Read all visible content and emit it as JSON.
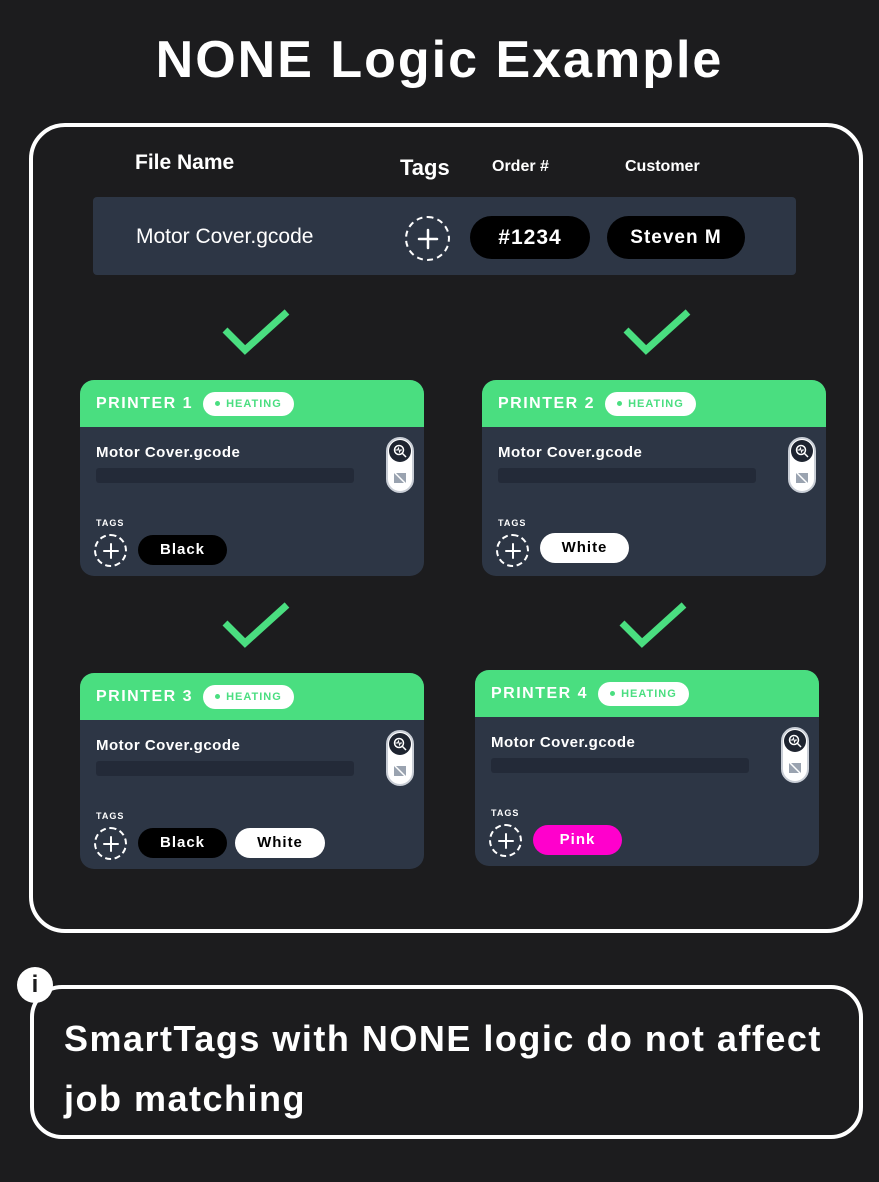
{
  "title": "NONE Logic Example",
  "columns": {
    "file_name": "File Name",
    "tags": "Tags",
    "order": "Order #",
    "customer": "Customer"
  },
  "file_row": {
    "file_name": "Motor Cover.gcode",
    "add_tag_icon": "plus-dashed-circle",
    "order": "#1234",
    "customer": "Steven M"
  },
  "colors": {
    "accent_green": "#4ade80",
    "card_bg": "#2d3645",
    "page_bg": "#1c1c1e",
    "pink_tag": "#ff00cc"
  },
  "match_icon": "checkmark",
  "printers": [
    {
      "name": "PRINTER 1",
      "status": "HEATING",
      "job": "Motor Cover.gcode",
      "tags_label": "TAGS",
      "tags": [
        {
          "label": "Black",
          "style": "black"
        }
      ]
    },
    {
      "name": "PRINTER 2",
      "status": "HEATING",
      "job": "Motor Cover.gcode",
      "tags_label": "TAGS",
      "tags": [
        {
          "label": "White",
          "style": "white"
        }
      ]
    },
    {
      "name": "PRINTER 3",
      "status": "HEATING",
      "job": "Motor Cover.gcode",
      "tags_label": "TAGS",
      "tags": [
        {
          "label": "Black",
          "style": "black"
        },
        {
          "label": "White",
          "style": "white"
        }
      ]
    },
    {
      "name": "PRINTER 4",
      "status": "HEATING",
      "job": "Motor Cover.gcode",
      "tags_label": "TAGS",
      "tags": [
        {
          "label": "Pink",
          "style": "pink"
        }
      ]
    }
  ],
  "note": {
    "icon": "info",
    "icon_glyph": "i",
    "text": "SmartTags with NONE logic do not affect job matching"
  }
}
